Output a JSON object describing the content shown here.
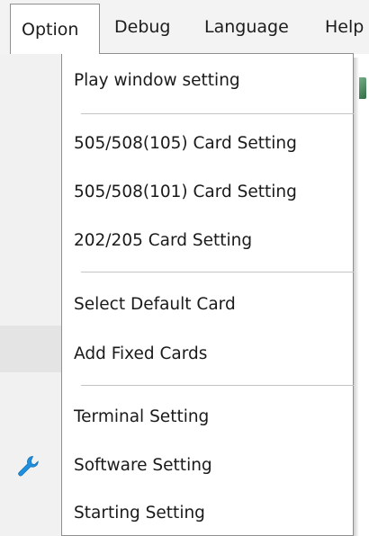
{
  "menubar": {
    "items": [
      {
        "label": "Option"
      },
      {
        "label": "Debug"
      },
      {
        "label": "Language"
      },
      {
        "label": "Help"
      }
    ]
  },
  "dropdown": {
    "items": [
      {
        "label": "Play window setting"
      },
      {
        "label": "505/508(105) Card Setting"
      },
      {
        "label": "505/508(101) Card Setting"
      },
      {
        "label": "202/205 Card Setting"
      },
      {
        "label": "Select Default Card"
      },
      {
        "label": "Add Fixed Cards"
      },
      {
        "label": "Terminal Setting"
      },
      {
        "label": "Software Setting",
        "icon": "wrench-icon"
      },
      {
        "label": "Starting Setting"
      }
    ]
  },
  "colors": {
    "icon_blue": "#1f8fe0",
    "separator": "#c4c4c4",
    "menubar_bg": "#f3f3f3"
  }
}
